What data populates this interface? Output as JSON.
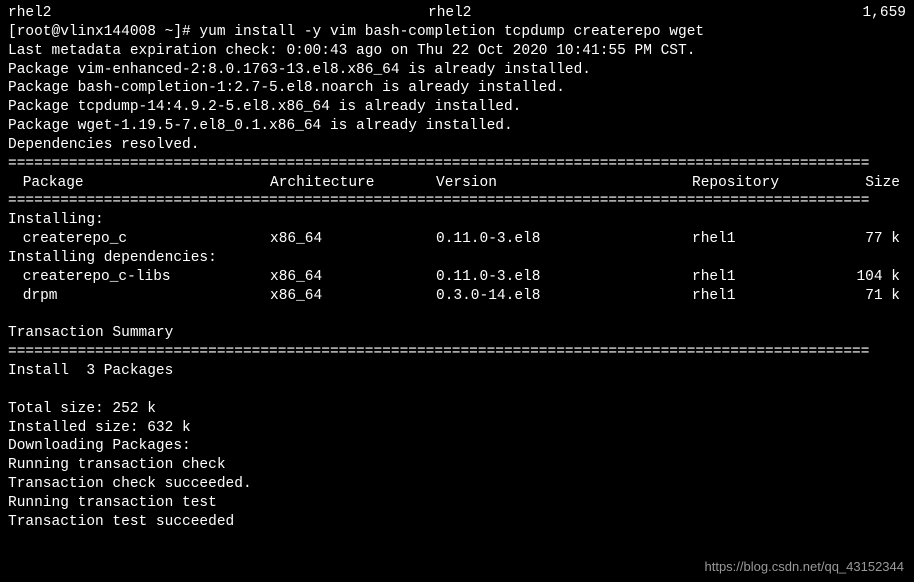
{
  "top": {
    "repo1": "rhel2",
    "repo2": "rhel2",
    "count": "1,659"
  },
  "prompt": "[root@vlinx144008 ~]# yum install -y vim bash-completion tcpdump createrepo wget",
  "metadata_line": "Last metadata expiration check: 0:00:43 ago on Thu 22 Oct 2020 10:41:55 PM CST.",
  "installed_lines": [
    "Package vim-enhanced-2:8.0.1763-13.el8.x86_64 is already installed.",
    "Package bash-completion-1:2.7-5.el8.noarch is already installed.",
    "Package tcpdump-14:4.9.2-5.el8.x86_64 is already installed.",
    "Package wget-1.19.5-7.el8_0.1.x86_64 is already installed."
  ],
  "deps_resolved": "Dependencies resolved.",
  "divider": "===================================================================================================",
  "headers": {
    "package": " Package",
    "arch": "Architecture",
    "version": "Version",
    "repo": "Repository",
    "size": "Size"
  },
  "installing_label": "Installing:",
  "installing_deps_label": "Installing dependencies:",
  "install_packages": [
    {
      "name": " createrepo_c",
      "arch": "x86_64",
      "version": "0.11.0-3.el8",
      "repo": "rhel1",
      "size": "77 k"
    }
  ],
  "dep_packages": [
    {
      "name": " createrepo_c-libs",
      "arch": "x86_64",
      "version": "0.11.0-3.el8",
      "repo": "rhel1",
      "size": "104 k"
    },
    {
      "name": " drpm",
      "arch": "x86_64",
      "version": "0.3.0-14.el8",
      "repo": "rhel1",
      "size": "71 k"
    }
  ],
  "transaction_summary": "Transaction Summary",
  "install_count": "Install  3 Packages",
  "total_size": "Total size: 252 k",
  "installed_size": "Installed size: 632 k",
  "downloading": "Downloading Packages:",
  "running_check": "Running transaction check",
  "check_succeeded": "Transaction check succeeded.",
  "running_test": "Running transaction test",
  "test_succeeded": "Transaction test succeeded",
  "watermark": "https://blog.csdn.net/qq_43152344"
}
